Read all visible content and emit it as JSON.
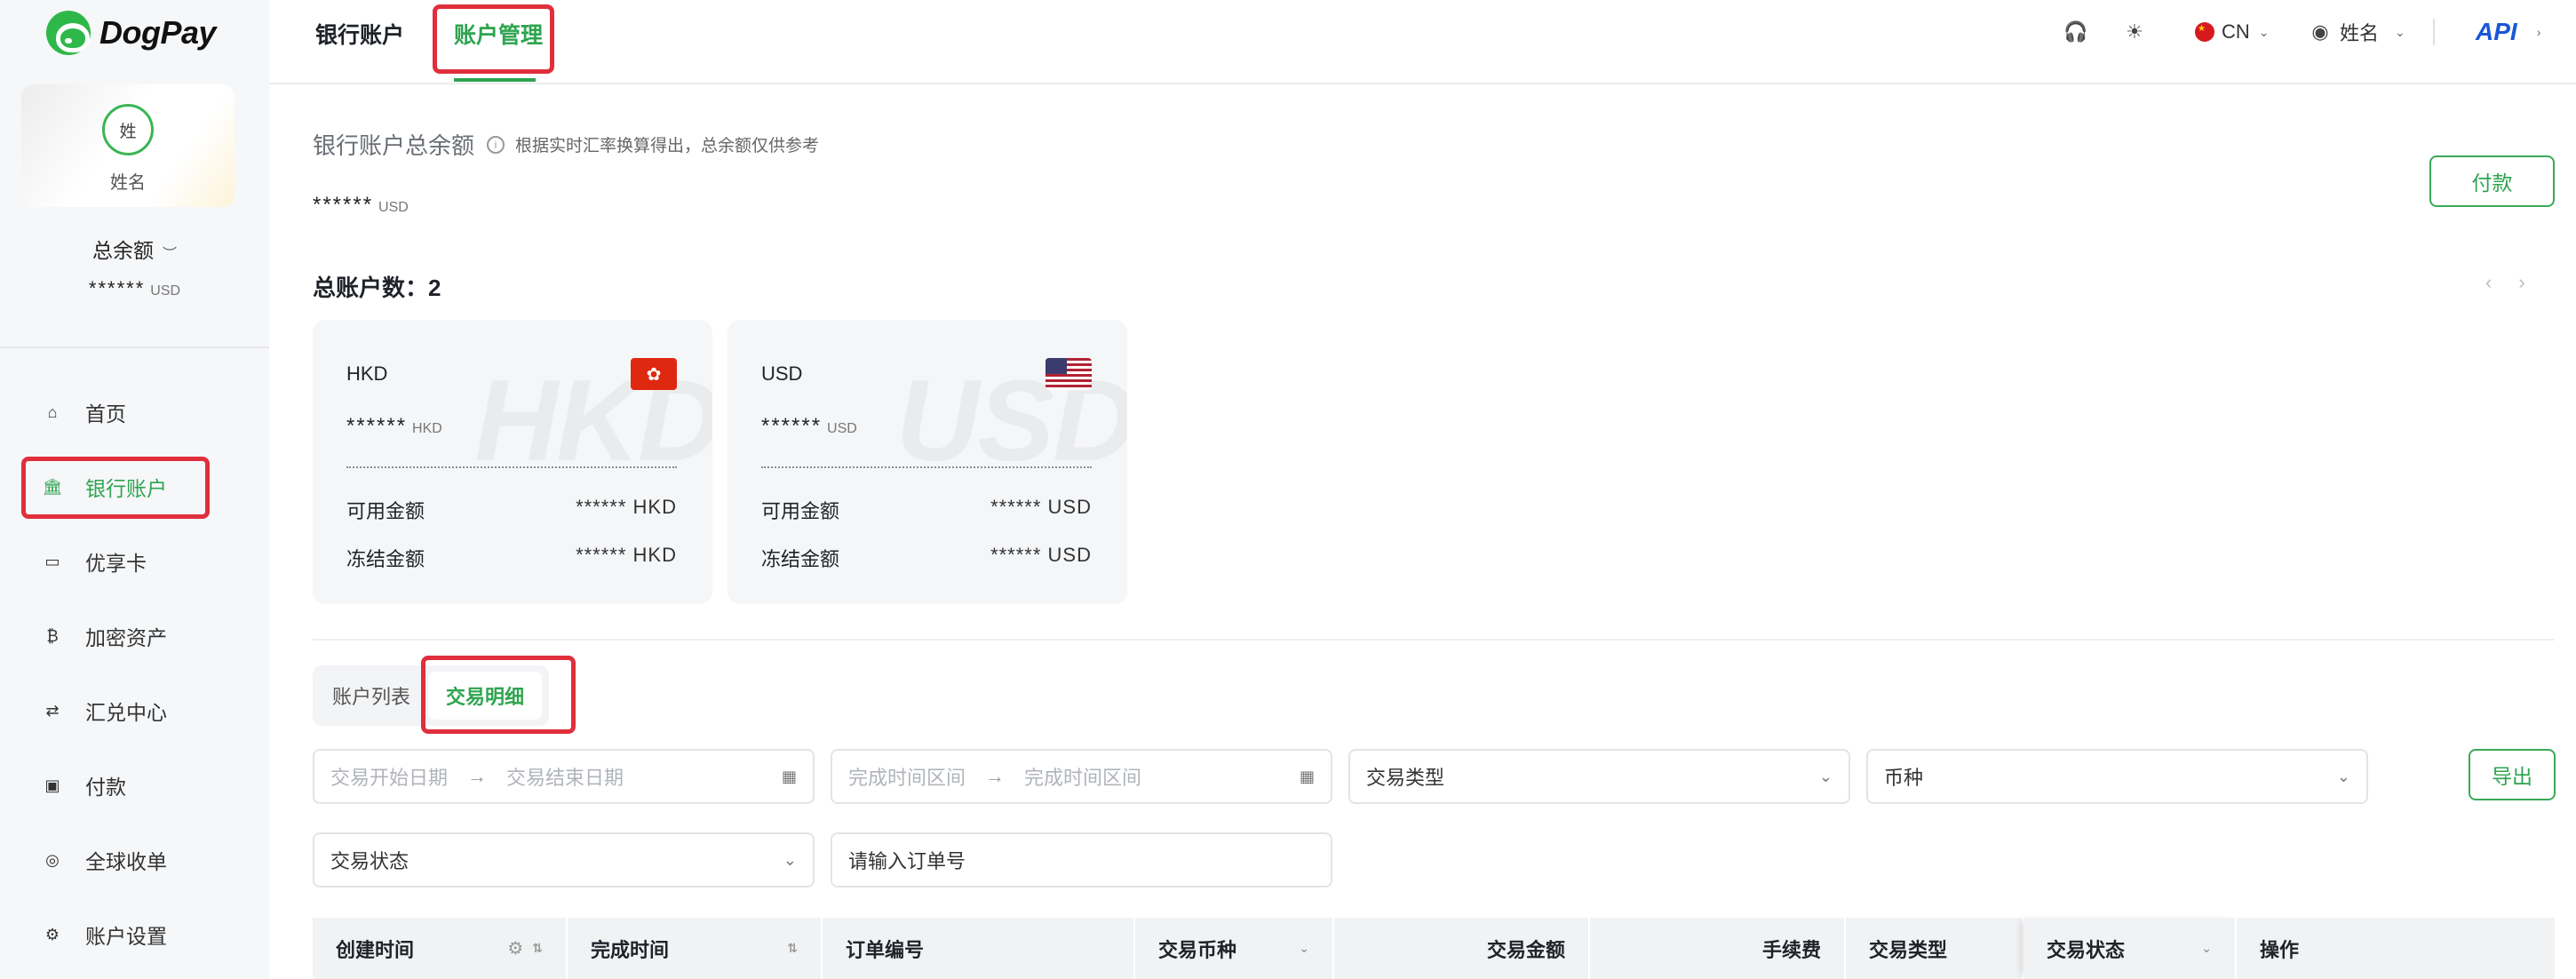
{
  "brand": {
    "name": "DogPay"
  },
  "profile": {
    "avatar_text": "姓",
    "name": "姓名"
  },
  "sidebar_balance": {
    "title": "总余额",
    "value": "******",
    "unit": "USD"
  },
  "nav": [
    {
      "label": "首页",
      "icon": "home-icon"
    },
    {
      "label": "银行账户",
      "icon": "bank-icon",
      "active": true
    },
    {
      "label": "优享卡",
      "icon": "card-icon"
    },
    {
      "label": "加密资产",
      "icon": "bitcoin-icon"
    },
    {
      "label": "汇兑中心",
      "icon": "exchange-icon"
    },
    {
      "label": "付款",
      "icon": "wallet-icon"
    },
    {
      "label": "全球收单",
      "icon": "global-collect-icon"
    },
    {
      "label": "账户设置",
      "icon": "gear-icon"
    }
  ],
  "header": {
    "tabs": [
      "银行账户",
      "账户管理"
    ],
    "active_tab": "账户管理",
    "language": "CN",
    "user": "姓名",
    "api_label": "API"
  },
  "summary": {
    "title": "银行账户总余额",
    "hint": "根据实时汇率换算得出，总余额仅供参考",
    "value": "******",
    "unit": "USD",
    "pay_label": "付款"
  },
  "accounts": {
    "count_label": "总账户数：",
    "count": "2",
    "cards": [
      {
        "currency": "HKD",
        "balance": "******",
        "unit": "HKD",
        "watermark": "HKD",
        "available_label": "可用金额",
        "available": "****** HKD",
        "frozen_label": "冻结金额",
        "frozen": "****** HKD"
      },
      {
        "currency": "USD",
        "balance": "******",
        "unit": "USD",
        "watermark": "USD",
        "available_label": "可用金额",
        "available": "****** USD",
        "frozen_label": "冻结金额",
        "frozen": "****** USD"
      }
    ]
  },
  "sub_tabs": [
    "账户列表",
    "交易明细"
  ],
  "filters": {
    "trade_start": "交易开始日期",
    "trade_end": "交易结束日期",
    "done_start": "完成时间区间",
    "done_end": "完成时间区间",
    "trade_type": "交易类型",
    "currency": "币种",
    "trade_status": "交易状态",
    "order_placeholder": "请输入订单号",
    "export_label": "导出"
  },
  "table": {
    "columns": [
      "创建时间",
      "完成时间",
      "订单编号",
      "交易币种",
      "交易金额",
      "手续费",
      "交易类型",
      "交易状态",
      "操作"
    ]
  },
  "colors": {
    "accent": "#2ea44f",
    "highlight": "#e02f3c",
    "api": "#1a56d6"
  }
}
